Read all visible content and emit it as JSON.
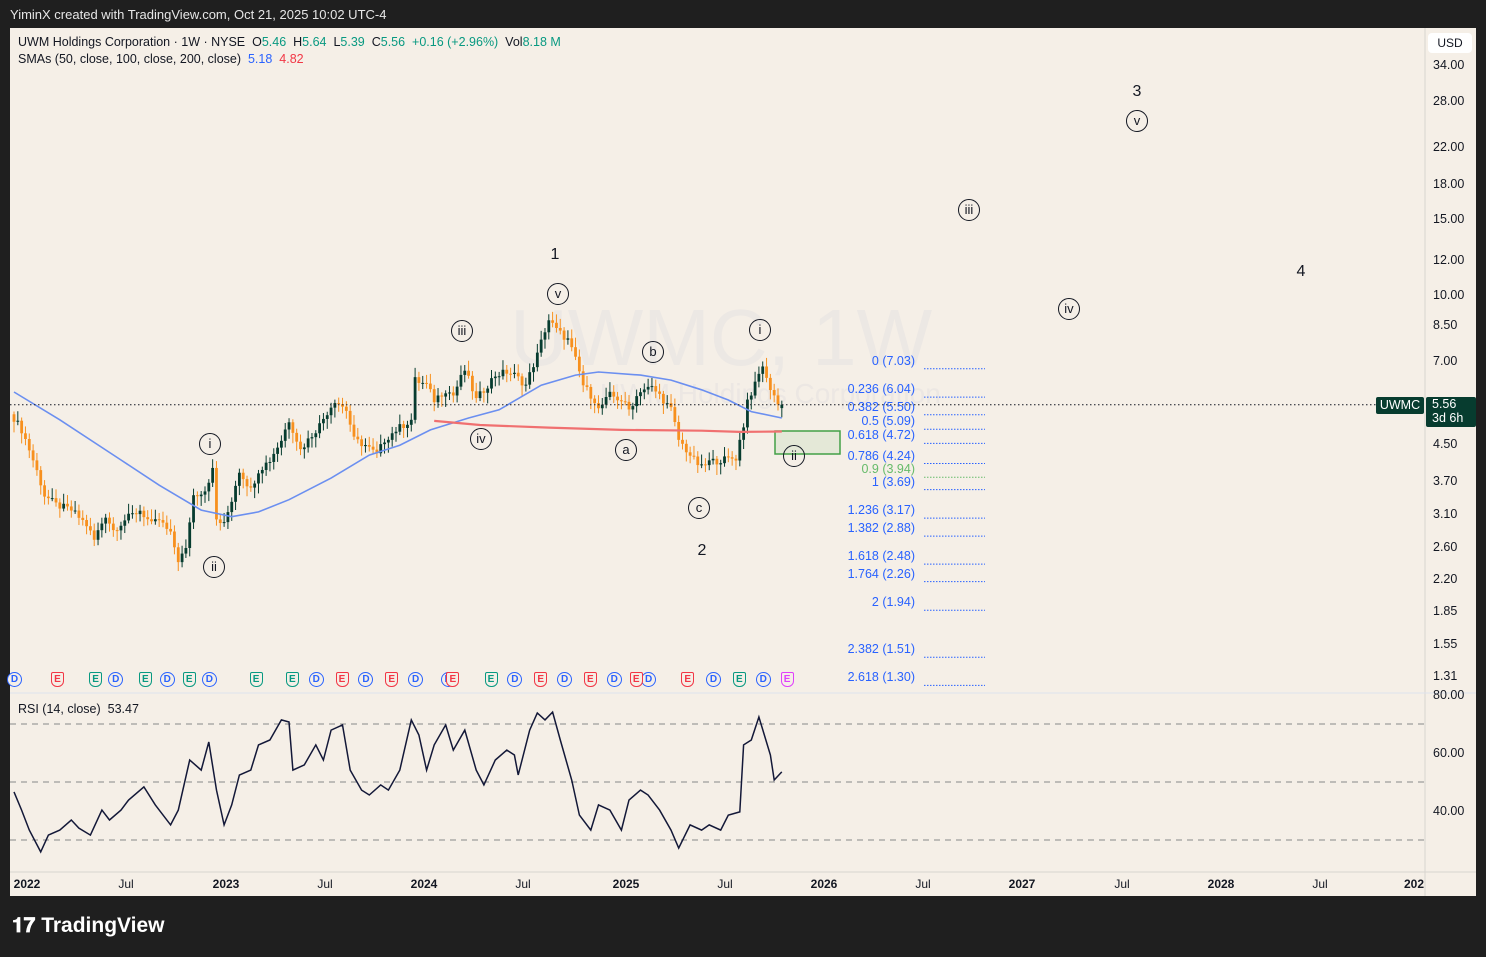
{
  "topbar": {
    "credit": "YiminX created with TradingView.com, Oct 21, 2025 10:02 UTC-4"
  },
  "legend": {
    "symbol": "UWM Holdings Corporation · 1W · NYSE",
    "o_label": "O",
    "o": "5.46",
    "h_label": "H",
    "h": "5.64",
    "l_label": "L",
    "l": "5.39",
    "c_label": "C",
    "c": "5.56",
    "change": "+0.16 (+2.96%)",
    "vol_label": "Vol",
    "vol": "8.18 M",
    "sma_label": "SMAs (50, close, 100, close, 200, close)",
    "sma1": "5.18",
    "sma2": "4.82"
  },
  "watermark": {
    "big": "UWMC, 1W",
    "small": "UWM Holdings Corporation"
  },
  "currency": "USD",
  "last_price": {
    "symbol": "UWMC",
    "price": "5.56",
    "countdown": "3d 6h"
  },
  "rsi": {
    "label": "RSI (14, close)",
    "value": "53.47"
  },
  "brand": "TradingView",
  "colors": {
    "bg": "#f5efe7",
    "up": "#073c2f",
    "down": "#f7901e",
    "sma50": "#6b8ff0",
    "sma200": "#f07070",
    "fib": "#2962ff",
    "rsi": "#131838"
  },
  "wave_labels": {
    "w1": "1",
    "w1v": "v",
    "w1iii": "iii",
    "w1iv": "iv",
    "w1i": "i",
    "w1ii": "ii",
    "wb": "b",
    "wa": "a",
    "wc": "c",
    "w2": "2",
    "w3i": "i",
    "w3ii": "ii",
    "w3iii": "iii",
    "w3iv": "iv",
    "w3v": "v",
    "w3": "3",
    "w4": "4"
  },
  "chart_data": {
    "type": "candlestick",
    "title": "UWM Holdings Corporation · 1W · NYSE",
    "scale": "log",
    "start_week": "2022-01-03",
    "ylim": [
      1.31,
      34.0
    ],
    "y_ticks": [
      "34.00",
      "28.00",
      "22.00",
      "18.00",
      "15.00",
      "12.00",
      "10.00",
      "8.50",
      "7.00",
      "4.50",
      "3.70",
      "3.10",
      "2.60",
      "2.20",
      "1.85",
      "1.55",
      "1.31"
    ],
    "x_ticks": [
      "2022",
      "Jul",
      "2023",
      "Jul",
      "2024",
      "Jul",
      "2025",
      "Jul",
      "2026",
      "Jul",
      "2027",
      "Jul",
      "2028",
      "Jul",
      "202"
    ],
    "close_keypoints": [
      [
        0,
        5.18
      ],
      [
        2,
        4.86
      ],
      [
        5,
        4.14
      ],
      [
        8,
        3.43
      ],
      [
        11,
        3.26
      ],
      [
        15,
        3.17
      ],
      [
        19,
        2.93
      ],
      [
        21,
        2.7
      ],
      [
        24,
        3.09
      ],
      [
        26,
        2.85
      ],
      [
        29,
        3.01
      ],
      [
        33,
        3.17
      ],
      [
        36,
        2.93
      ],
      [
        38,
        3.01
      ],
      [
        41,
        2.78
      ],
      [
        43,
        2.43
      ],
      [
        45,
        2.56
      ],
      [
        47,
        3.43
      ],
      [
        50,
        3.53
      ],
      [
        52,
        3.92
      ],
      [
        53,
        3.01
      ],
      [
        55,
        2.93
      ],
      [
        57,
        3.35
      ],
      [
        59,
        3.92
      ],
      [
        62,
        3.53
      ],
      [
        64,
        3.92
      ],
      [
        67,
        4.14
      ],
      [
        70,
        4.61
      ],
      [
        72,
        5.13
      ],
      [
        75,
        4.37
      ],
      [
        77,
        4.61
      ],
      [
        80,
        4.99
      ],
      [
        84,
        5.7
      ],
      [
        87,
        5.41
      ],
      [
        89,
        4.61
      ],
      [
        92,
        4.48
      ],
      [
        95,
        4.25
      ],
      [
        97,
        4.61
      ],
      [
        100,
        4.86
      ],
      [
        104,
        5.13
      ],
      [
        105,
        6.34
      ],
      [
        108,
        6.17
      ],
      [
        110,
        5.7
      ],
      [
        113,
        6.02
      ],
      [
        115,
        5.85
      ],
      [
        118,
        6.69
      ],
      [
        121,
        5.7
      ],
      [
        123,
        6.02
      ],
      [
        126,
        6.51
      ],
      [
        129,
        6.62
      ],
      [
        131,
        6.51
      ],
      [
        134,
        6.17
      ],
      [
        137,
        7.25
      ],
      [
        139,
        8.28
      ],
      [
        140,
        8.74
      ],
      [
        142,
        8.28
      ],
      [
        145,
        7.85
      ],
      [
        147,
        7.06
      ],
      [
        149,
        6.17
      ],
      [
        152,
        5.7
      ],
      [
        153,
        5.41
      ],
      [
        156,
        5.85
      ],
      [
        159,
        5.7
      ],
      [
        161,
        5.41
      ],
      [
        164,
        6.02
      ],
      [
        167,
        6.08
      ],
      [
        169,
        5.85
      ],
      [
        172,
        5.41
      ],
      [
        174,
        4.61
      ],
      [
        176,
        4.37
      ],
      [
        178,
        4.14
      ],
      [
        180,
        3.97
      ],
      [
        182,
        4.1
      ],
      [
        185,
        4.14
      ],
      [
        189,
        4.19
      ],
      [
        191,
        4.99
      ],
      [
        192,
        5.7
      ],
      [
        194,
        6.17
      ],
      [
        196,
        6.87
      ],
      [
        197,
        6.34
      ],
      [
        199,
        5.85
      ],
      [
        200,
        5.55
      ],
      [
        201,
        5.56
      ]
    ],
    "sma50": [
      [
        0,
        5.95
      ],
      [
        12,
        5.13
      ],
      [
        28,
        4.14
      ],
      [
        38,
        3.62
      ],
      [
        49,
        3.17
      ],
      [
        57,
        3.06
      ],
      [
        64,
        3.14
      ],
      [
        72,
        3.35
      ],
      [
        83,
        3.76
      ],
      [
        93,
        4.25
      ],
      [
        101,
        4.48
      ],
      [
        109,
        4.86
      ],
      [
        119,
        5.18
      ],
      [
        127,
        5.41
      ],
      [
        138,
        6.17
      ],
      [
        147,
        6.51
      ],
      [
        153,
        6.62
      ],
      [
        164,
        6.51
      ],
      [
        172,
        6.34
      ],
      [
        180,
        6.02
      ],
      [
        187,
        5.7
      ],
      [
        193,
        5.36
      ],
      [
        201,
        5.18
      ]
    ],
    "sma200": [
      [
        110,
        5.1
      ],
      [
        122,
        4.99
      ],
      [
        140,
        4.92
      ],
      [
        159,
        4.86
      ],
      [
        180,
        4.84
      ],
      [
        190,
        4.81
      ],
      [
        201,
        4.82
      ]
    ],
    "fib_levels": [
      {
        "ratio": "0",
        "price": 7.03
      },
      {
        "ratio": "0.236",
        "price": 6.04
      },
      {
        "ratio": "0.382",
        "price": 5.5
      },
      {
        "ratio": "0.5",
        "price": 5.09
      },
      {
        "ratio": "0.618",
        "price": 4.72
      },
      {
        "ratio": "0.786",
        "price": 4.24
      },
      {
        "ratio": "0.9",
        "price": 3.94,
        "highlight": true
      },
      {
        "ratio": "1",
        "price": 3.69
      },
      {
        "ratio": "1.236",
        "price": 3.17
      },
      {
        "ratio": "1.382",
        "price": 2.88
      },
      {
        "ratio": "1.618",
        "price": 2.48
      },
      {
        "ratio": "1.764",
        "price": 2.26
      },
      {
        "ratio": "2",
        "price": 1.94
      },
      {
        "ratio": "2.382",
        "price": 1.51
      },
      {
        "ratio": "2.618",
        "price": 1.3
      }
    ],
    "target_zone": [
      4.25,
      4.86
    ],
    "rsi_ylim": [
      20,
      80
    ],
    "rsi_ticks": [
      "80.00",
      "60.00",
      "40.00"
    ],
    "rsi_bands": [
      70,
      50,
      30
    ],
    "rsi_series": [
      [
        0,
        46.6
      ],
      [
        2,
        40.3
      ],
      [
        4,
        33.4
      ],
      [
        7,
        25.9
      ],
      [
        9,
        31.7
      ],
      [
        12,
        33.4
      ],
      [
        15,
        36.9
      ],
      [
        17,
        34.1
      ],
      [
        20,
        31.7
      ],
      [
        23,
        40.3
      ],
      [
        25,
        36.9
      ],
      [
        28,
        40.3
      ],
      [
        30,
        43.8
      ],
      [
        34,
        48.3
      ],
      [
        37,
        42.1
      ],
      [
        41,
        35.2
      ],
      [
        43,
        40.3
      ],
      [
        46,
        57.6
      ],
      [
        49,
        54.1
      ],
      [
        51,
        63.8
      ],
      [
        53,
        47.2
      ],
      [
        55,
        35.2
      ],
      [
        57,
        42.1
      ],
      [
        59,
        52.4
      ],
      [
        62,
        54.1
      ],
      [
        64,
        62.8
      ],
      [
        67,
        64.5
      ],
      [
        70,
        71.4
      ],
      [
        72,
        70.7
      ],
      [
        73,
        54.1
      ],
      [
        76,
        55.9
      ],
      [
        79,
        62.8
      ],
      [
        81,
        57.6
      ],
      [
        83,
        67.9
      ],
      [
        86,
        69.7
      ],
      [
        88,
        54.1
      ],
      [
        91,
        47.2
      ],
      [
        93,
        45.5
      ],
      [
        96,
        49.0
      ],
      [
        98,
        47.2
      ],
      [
        101,
        54.1
      ],
      [
        104,
        71.4
      ],
      [
        106,
        66.2
      ],
      [
        108,
        54.1
      ],
      [
        110,
        62.8
      ],
      [
        113,
        69.7
      ],
      [
        115,
        61.0
      ],
      [
        118,
        67.9
      ],
      [
        121,
        54.1
      ],
      [
        123,
        49.0
      ],
      [
        126,
        57.6
      ],
      [
        129,
        61.0
      ],
      [
        131,
        59.3
      ],
      [
        132,
        52.4
      ],
      [
        135,
        67.9
      ],
      [
        137,
        73.8
      ],
      [
        139,
        71.4
      ],
      [
        141,
        74.1
      ],
      [
        143,
        64.5
      ],
      [
        146,
        50.7
      ],
      [
        148,
        38.6
      ],
      [
        151,
        33.4
      ],
      [
        153,
        42.1
      ],
      [
        156,
        40.3
      ],
      [
        159,
        33.4
      ],
      [
        161,
        43.8
      ],
      [
        164,
        47.2
      ],
      [
        166,
        45.5
      ],
      [
        169,
        40.3
      ],
      [
        172,
        33.4
      ],
      [
        174,
        27.2
      ],
      [
        177,
        35.2
      ],
      [
        180,
        33.4
      ],
      [
        182,
        35.2
      ],
      [
        185,
        33.4
      ],
      [
        187,
        38.6
      ],
      [
        190,
        39.7
      ],
      [
        191,
        62.8
      ],
      [
        193,
        64.5
      ],
      [
        195,
        72.4
      ],
      [
        198,
        59.3
      ],
      [
        199,
        50.7
      ],
      [
        201,
        53.47
      ]
    ],
    "events": [
      [
        0,
        "D",
        ""
      ],
      [
        11.5,
        "E",
        "red"
      ],
      [
        21.5,
        "E",
        "green"
      ],
      [
        26.5,
        "D",
        ""
      ],
      [
        34.5,
        "E",
        "green"
      ],
      [
        40,
        "D",
        ""
      ],
      [
        46,
        "E",
        "green"
      ],
      [
        51,
        "D",
        ""
      ],
      [
        63.5,
        "E",
        "green"
      ],
      [
        73,
        "E",
        "green"
      ],
      [
        79,
        "D",
        ""
      ],
      [
        86,
        "E",
        "red"
      ],
      [
        92,
        "D",
        ""
      ],
      [
        99,
        "E",
        "red"
      ],
      [
        105,
        "D",
        ""
      ],
      [
        113.5,
        "D",
        ""
      ],
      [
        115,
        "E",
        "red"
      ],
      [
        125,
        "E",
        "green"
      ],
      [
        131,
        "D",
        ""
      ],
      [
        138,
        "E",
        "red"
      ],
      [
        144,
        "D",
        ""
      ],
      [
        151,
        "E",
        "red"
      ],
      [
        157,
        "D",
        ""
      ],
      [
        166,
        "D",
        ""
      ],
      [
        163,
        "E",
        "red"
      ],
      [
        176.5,
        "E",
        "red"
      ],
      [
        183,
        "D",
        ""
      ],
      [
        190,
        "E",
        "green"
      ],
      [
        196,
        "D",
        ""
      ],
      [
        202.5,
        "E",
        "magenta"
      ]
    ]
  }
}
